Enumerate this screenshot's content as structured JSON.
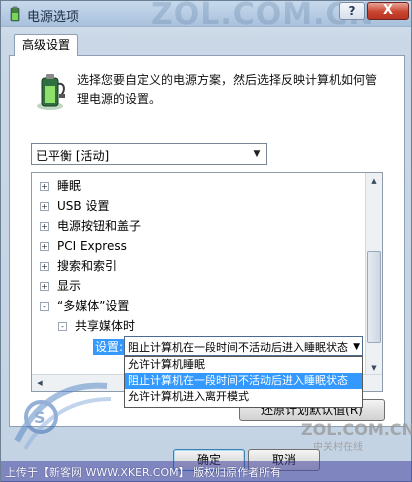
{
  "window": {
    "title": "电源选项",
    "help_label": "?",
    "close_label": "X",
    "watermark": "ZOL.COM.CN"
  },
  "tab": {
    "label": "高级设置"
  },
  "description": "选择您要自定义的电源方案，然后选择反映计算机如何管理电源的设置。",
  "plan_select": {
    "value": "已平衡 [活动]"
  },
  "tree": {
    "items": [
      {
        "symbol": "+",
        "label": "睡眠"
      },
      {
        "symbol": "+",
        "label": "USB 设置"
      },
      {
        "symbol": "+",
        "label": "电源按钮和盖子"
      },
      {
        "symbol": "+",
        "label": "PCI Express"
      },
      {
        "symbol": "+",
        "label": "搜索和索引"
      },
      {
        "symbol": "+",
        "label": "显示"
      },
      {
        "symbol": "-",
        "label": "“多媒体”设置"
      }
    ],
    "sub_item": {
      "symbol": "-",
      "label": "共享媒体时"
    },
    "setting_label": "设置:",
    "setting_value": "阻止计算机在一段时间不活动后进入睡眠状态",
    "options": [
      "允许计算机睡眠",
      "阻止计算机在一段时间不活动后进入睡眠状态",
      "允许计算机进入离开模式"
    ],
    "selected_index": 1
  },
  "buttons": {
    "restore": "还原计划默认值(R)",
    "ok": "确定",
    "cancel": "取消"
  },
  "watermarks": {
    "zol": "ZOL.COM.CN",
    "zol_sub": "中关村在线",
    "bottom": "上传于【新客网 WWW.XKER.COM】 版权归原作者所有"
  },
  "colors": {
    "selection": "#3399ff",
    "close_button": "#c9452f"
  }
}
